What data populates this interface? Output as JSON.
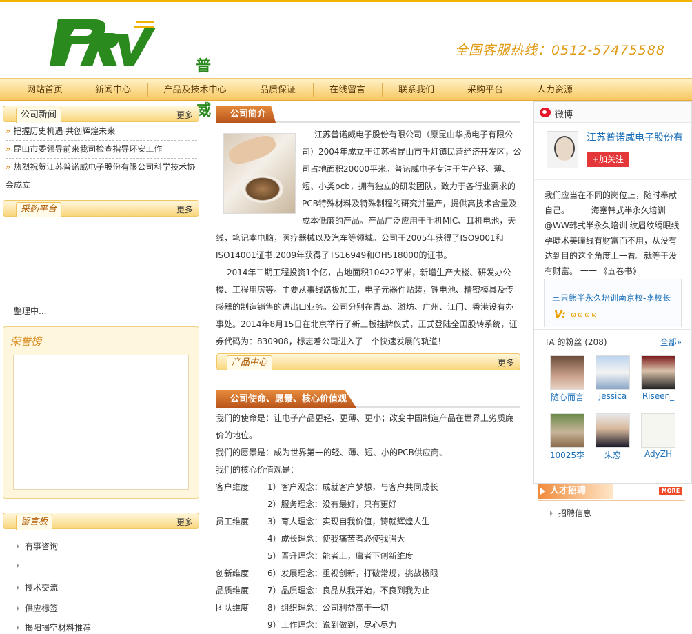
{
  "brand": {
    "logo_text": "PRV",
    "logo_cn": "普诺威",
    "hotline": "全国客服热线：0512-57475588",
    "colors": {
      "green": "#2b8a1e",
      "orange": "#e09a14",
      "accent": "#f0b400"
    }
  },
  "nav": [
    "网站首页",
    "新闻中心",
    "产品及技术中心",
    "品质保证",
    "在线留言",
    "联系我们",
    "采购平台",
    "人力资源"
  ],
  "left": {
    "news": {
      "title": "公司新闻",
      "more": "更多",
      "items": [
        "把握历史机遇 共创辉煌未来",
        "昆山市委领导前来我司检查指导环安工作",
        "热烈祝贺江苏普诺威电子股份有限公司科学技术协",
        "会成立"
      ]
    },
    "purchase": {
      "title": "采购平台",
      "more": "更多",
      "status": "整理中..."
    },
    "honor": {
      "title": "荣誉榜"
    },
    "message": {
      "title": "留言板",
      "more": "更多",
      "items": [
        "有事咨询",
        "",
        "技术交流",
        "供应标签",
        "揭阳揭空材料推荐"
      ]
    }
  },
  "middle": {
    "intro": {
      "title": "公司简介",
      "photo": "coffee-photo",
      "lines_wrap": [
        "江苏普诺威电子股份有限公司（原昆山华扬电子有限公",
        "司）2004年成立于江苏省昆山市千灯镇民营经济开发区，公",
        "司占地面积20000平米。普诺威电子专注于生产轻、薄、",
        "短、小类pcb，拥有独立的研发团队，致力于各行业需求的",
        "PCB特殊材料及特殊制程的研究并量产，提供高技术含量及",
        "成本低廉的产品。产品广泛应用于手机MIC、耳机电池，天"
      ],
      "lines_full": [
        "线，笔记本电脑，医疗器械以及汽车等领域。公司于2005年获得了ISO9001和",
        "ISO14001证书,2009年获得了TS16949和OHS18000的证书。",
        "2014年二期工程投资1个亿，占地面积10422平米，新增生产大楼、研发办公",
        "楼、工程用房等。主要从事线路板加工，电子元器件贴装，锂电池、精密模具及传",
        "感器的制造销售的进出口业务。公司分别在青岛、潍坊、广州、江门、香港设有办",
        "事处。2014年8月15日在北京举行了新三板挂牌仪式，正式登陆全国股转系统，证",
        "券代码为：830908，标志着公司进入了一个快速发展的轨道！"
      ]
    },
    "products": {
      "title": "产品中心",
      "more": "更多"
    },
    "mission": {
      "title": "公司使命、愿景、核心价值观",
      "lines": [
        "我们的使命是：让电子产品更轻、更薄、更小；改变中国制造产品在世界上劣质廉",
        "价的地位。",
        "我们的愿景是：成为世界第一的轻、薄、短、小的PCB供应商、",
        "我们的核心价值观是："
      ],
      "values": [
        {
          "cat": "客户维度",
          "text": "1）客户观念：成就客户梦想，与客户共同成长"
        },
        {
          "cat": "",
          "text": "2）服务理念：没有最好，只有更好"
        },
        {
          "cat": "员工维度",
          "text": "3）育人理念：实现自我价值，铸就辉煌人生"
        },
        {
          "cat": "",
          "text": "4）成长理念：使我痛苦者必使我强大"
        },
        {
          "cat": "",
          "text": "5）晋升理念：能者上，庸者下创新维度"
        },
        {
          "cat": "创新维度",
          "text": "6）发展理念：重视创新，打破常规，挑战极限"
        },
        {
          "cat": "品质维度",
          "text": "7）品质理念：良品从我开始，不良到我为止"
        },
        {
          "cat": "团队维度",
          "text": "8）组织理念：公司利益高于一切"
        },
        {
          "cat": "",
          "text": "9）工作理念：说到做到，尽心尽力"
        }
      ]
    }
  },
  "right": {
    "weibo": {
      "title": "微博",
      "account": "江苏普诺威电子股份有",
      "follow": "+加关注",
      "post": "我们应当在不同的岗位上，随时奉献自己。 一一 海塞韩式半永久培训@WW韩式半永久培训 纹眉纹绣眼线孕睫术美瞳线有财富而不用，从没有达到目的这个角度上一看。就等于没有财富。 一一 《五卷书》",
      "quote_link": "三只熊半永久培训南京校-李校长",
      "v": "V:",
      "badges": "ɷɷɷɷ",
      "fans_title": "TA 的粉丝 (208)",
      "fans_more": "全部»",
      "fans": [
        "随心而言",
        "jessica",
        "Riseen_",
        "10025李",
        "朱恋",
        "AdyZH"
      ]
    },
    "jobs": {
      "title": "人才招聘",
      "more": "MORE",
      "items": [
        "招聘信息"
      ]
    }
  }
}
